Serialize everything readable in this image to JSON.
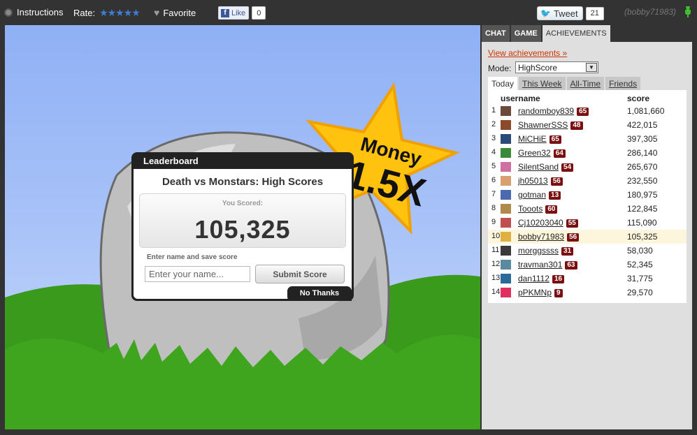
{
  "topbar": {
    "instructions": "Instructions",
    "rate_label": "Rate:",
    "rating_stars": "★★★★★",
    "favorite": "Favorite",
    "like_label": "Like",
    "like_count": "0",
    "tweet_label": "Tweet",
    "tweet_count": "21",
    "current_user": "(bobby71983)"
  },
  "game": {
    "banner_top": "Money",
    "banner_bottom": "1.5X"
  },
  "leaderboard_modal": {
    "header": "Leaderboard",
    "title": "Death vs Monstars: High Scores",
    "you_scored_label": "You Scored:",
    "score": "105,325",
    "save_label": "Enter name and save score",
    "name_placeholder": "Enter your name...",
    "submit_label": "Submit Score",
    "no_thanks_label": "No Thanks"
  },
  "panel": {
    "tabs": [
      "CHAT",
      "GAME",
      "ACHIEVEMENTS"
    ],
    "active_tab": "ACHIEVEMENTS",
    "view_achievements": "View achievements »",
    "mode_label": "Mode:",
    "mode_value": "HighScore",
    "sub_tabs": [
      "Today",
      "This Week",
      "All-Time",
      "Friends"
    ],
    "active_sub_tab": "Today",
    "columns": {
      "username": "username",
      "score": "score"
    },
    "rows": [
      {
        "rank": "1",
        "user": "randomboy839",
        "level": "65",
        "score": "1,081,660",
        "avatar": "#6b4a3a"
      },
      {
        "rank": "2",
        "user": "ShawnerSSS",
        "level": "48",
        "score": "422,015",
        "avatar": "#8c4a2a"
      },
      {
        "rank": "3",
        "user": "MiCHiE",
        "level": "65",
        "score": "397,305",
        "avatar": "#2a4a7a"
      },
      {
        "rank": "4",
        "user": "Green32",
        "level": "64",
        "score": "286,140",
        "avatar": "#3a8a3a"
      },
      {
        "rank": "5",
        "user": "SilentSand",
        "level": "54",
        "score": "265,670",
        "avatar": "#d070a0"
      },
      {
        "rank": "6",
        "user": "jh05013",
        "level": "56",
        "score": "232,550",
        "avatar": "#d8a070"
      },
      {
        "rank": "7",
        "user": "gotman",
        "level": "13",
        "score": "180,975",
        "avatar": "#4a6ab0"
      },
      {
        "rank": "8",
        "user": "Tooots",
        "level": "60",
        "score": "122,845",
        "avatar": "#b08a4a"
      },
      {
        "rank": "9",
        "user": "Cj10203040",
        "level": "55",
        "score": "115,090",
        "avatar": "#c05050"
      },
      {
        "rank": "10",
        "user": "bobby71983",
        "level": "56",
        "score": "105,325",
        "avatar": "#e0b040",
        "me": true
      },
      {
        "rank": "11",
        "user": "morggssss",
        "level": "31",
        "score": "58,030",
        "avatar": "#3a3a3a"
      },
      {
        "rank": "12",
        "user": "travman301",
        "level": "63",
        "score": "52,345",
        "avatar": "#5a8aa0"
      },
      {
        "rank": "13",
        "user": "dan1112",
        "level": "16",
        "score": "31,775",
        "avatar": "#2a6a9a"
      },
      {
        "rank": "14",
        "user": "pPKMNp",
        "level": "9",
        "score": "29,570",
        "avatar": "#e03060"
      }
    ]
  },
  "colors": {
    "topbar_bg": "#333333",
    "panel_bg": "#dfdfdf",
    "link_red": "#cc3300",
    "level_badge": "#7a1010",
    "grass": "#3fa51e",
    "star": "#ffc20e"
  }
}
